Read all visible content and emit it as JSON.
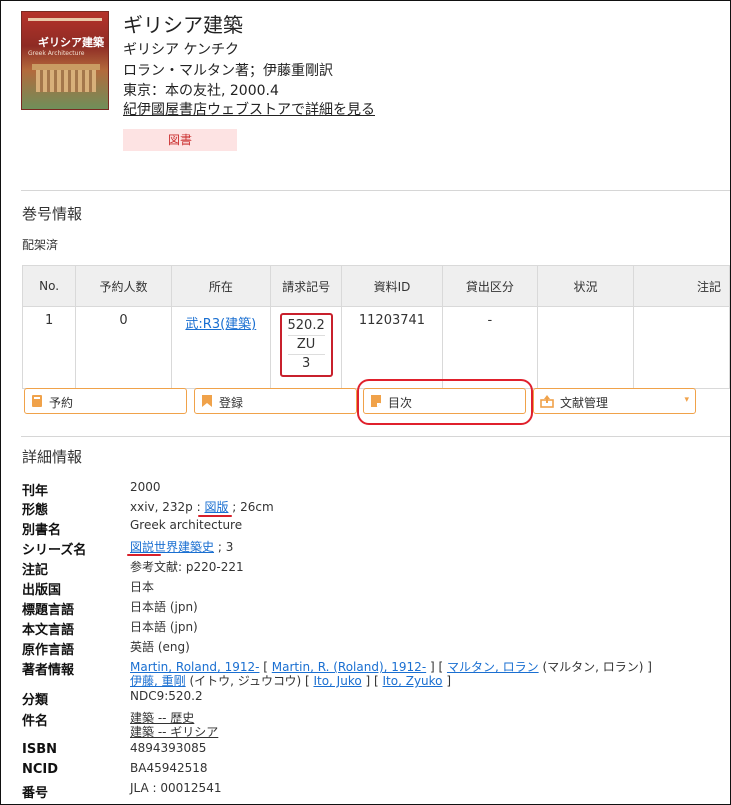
{
  "book": {
    "title": "ギリシア建築",
    "reading": "ギリシア ケンチク",
    "authors": "ロラン・マルタン著；伊藤重剛訳",
    "publication": "東京：本の友社, 2000.4",
    "store_link": "紀伊國屋書店ウェブストアで詳細を見る",
    "type_badge": "図書",
    "cover_title": "ギリシア建築",
    "cover_subtitle": "Greek Architecture"
  },
  "volume_section": {
    "title": "巻号情報",
    "shelf_status": "配架済",
    "headers": [
      "No.",
      "予約人数",
      "所在",
      "請求記号",
      "資料ID",
      "貸出区分",
      "状況",
      "注記"
    ],
    "row": {
      "no": "1",
      "reservations": "0",
      "location": "武:R3(建築)",
      "call_number": [
        "520.2",
        "ZU",
        "3"
      ],
      "item_id": "11203741",
      "loan_type": "-",
      "status": "",
      "note": ""
    }
  },
  "actions": {
    "reserve": "予約",
    "register": "登録",
    "toc": "目次",
    "ref_manage": "文献管理"
  },
  "details": {
    "title": "詳細情報",
    "year_label": "刊年",
    "year": "2000",
    "form_label": "形態",
    "form_pre": "xxiv, 232p : ",
    "form_link": "図版",
    "form_post": " ; 26cm",
    "alt_title_label": "別書名",
    "alt_title": "Greek architecture",
    "series_label": "シリーズ名",
    "series_link": "図説世界建築史",
    "series_post": " ; 3",
    "note_label": "注記",
    "note": "参考文献: p220-221",
    "country_label": "出版国",
    "country": "日本",
    "title_lang_label": "標題言語",
    "title_lang": "日本語 (jpn)",
    "text_lang_label": "本文言語",
    "text_lang": "日本語 (jpn)",
    "orig_lang_label": "原作言語",
    "orig_lang": "英語 (eng)",
    "author_info_label": "著者情報",
    "author1_link": "Martin, Roland, 1912-",
    "author1_alt_link": "Martin, R. (Roland), 1912-",
    "author1_kana_link": "マルタン, ロラン",
    "author1_kana_read": "(マルタン, ロラン)",
    "author2_link": "伊藤, 重剛",
    "author2_read": "(イトウ, ジュウコウ)",
    "author2_alt1": "Ito, Juko",
    "author2_alt2": "Ito, Zyuko",
    "class_label": "分類",
    "class": "NDC9:520.2",
    "subject_label": "件名",
    "subject1": "建築 -- 歴史",
    "subject2": "建築 -- ギリシア",
    "isbn_label": "ISBN",
    "isbn": "4894393085",
    "ncid_label": "NCID",
    "ncid": "BA45942518",
    "number_label": "番号",
    "number": "JLA : 00012541"
  }
}
